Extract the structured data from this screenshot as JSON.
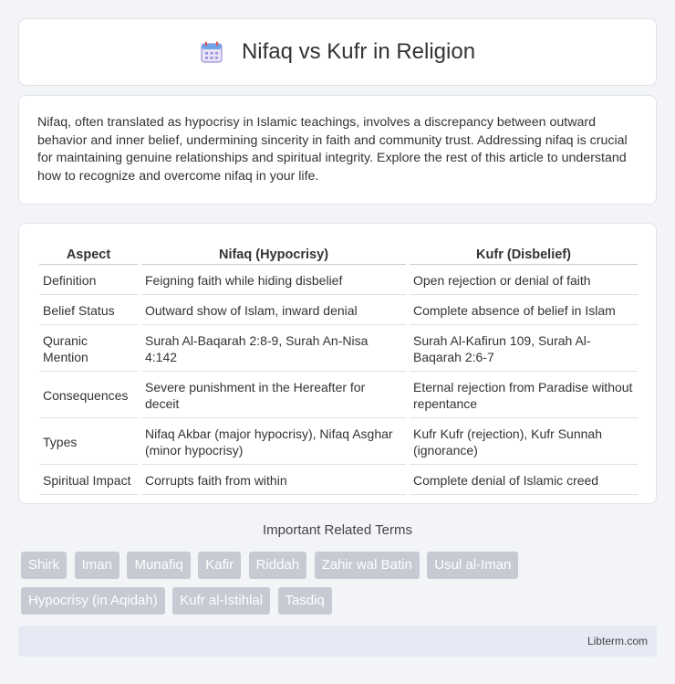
{
  "header": {
    "title": "Nifaq vs Kufr in Religion",
    "icon": "calendar-icon"
  },
  "intro": "Nifaq, often translated as hypocrisy in Islamic teachings, involves a discrepancy between outward behavior and inner belief, undermining sincerity in faith and community trust. Addressing nifaq is crucial for maintaining genuine relationships and spiritual integrity. Explore the rest of this article to understand how to recognize and overcome nifaq in your life.",
  "table": {
    "headers": [
      "Aspect",
      "Nifaq (Hypocrisy)",
      "Kufr (Disbelief)"
    ],
    "rows": [
      [
        "Definition",
        "Feigning faith while hiding disbelief",
        "Open rejection or denial of faith"
      ],
      [
        "Belief Status",
        "Outward show of Islam, inward denial",
        "Complete absence of belief in Islam"
      ],
      [
        "Quranic Mention",
        "Surah Al-Baqarah 2:8-9, Surah An-Nisa 4:142",
        "Surah Al-Kafirun 109, Surah Al-Baqarah 2:6-7"
      ],
      [
        "Consequences",
        "Severe punishment in the Hereafter for deceit",
        "Eternal rejection from Paradise without repentance"
      ],
      [
        "Types",
        "Nifaq Akbar (major hypocrisy), Nifaq Asghar (minor hypocrisy)",
        "Kufr Kufr (rejection), Kufr Sunnah (ignorance)"
      ],
      [
        "Spiritual Impact",
        "Corrupts faith from within",
        "Complete denial of Islamic creed"
      ]
    ]
  },
  "related": {
    "title": "Important Related Terms",
    "tags": [
      "Shirk",
      "Iman",
      "Munafiq",
      "Kafir",
      "Riddah",
      "Zahir wal Batin",
      "Usul al-Iman",
      "Hypocrisy (in Aqidah)",
      "Kufr al-Istihlal",
      "Tasdiq"
    ]
  },
  "footer": {
    "brand": "Libterm.com"
  }
}
